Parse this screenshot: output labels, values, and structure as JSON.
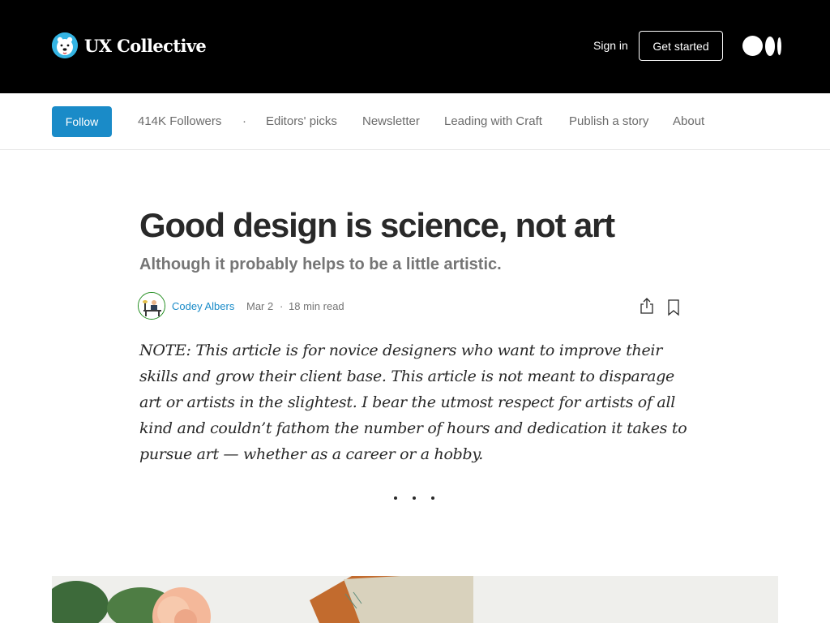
{
  "header": {
    "brand_name": "UX Collective",
    "sign_in": "Sign in",
    "get_started": "Get started"
  },
  "subnav": {
    "follow": "Follow",
    "followers": "414K Followers",
    "separator": "·",
    "items": [
      "Editors' picks",
      "Newsletter",
      "Leading with Craft",
      "Publish a story",
      "About"
    ]
  },
  "article": {
    "title": "Good design is science, not art",
    "subtitle": "Although it probably helps to be a little artistic.",
    "author": "Codey Albers",
    "date": "Mar 2",
    "meta_separator": "·",
    "read_time": "18 min read",
    "note": "NOTE: This article is for novice designers who want to improve their skills and grow their client base. This article is not meant to disparage art or artists in the slightest. I bear the utmost respect for artists of all kind and couldn’t fathom the number of hours and dedication it takes to pursue art — whether as a career or a hobby."
  },
  "colors": {
    "header_bg": "#000000",
    "accent": "#1a8bc8",
    "text": "#292929",
    "muted": "#757575"
  }
}
